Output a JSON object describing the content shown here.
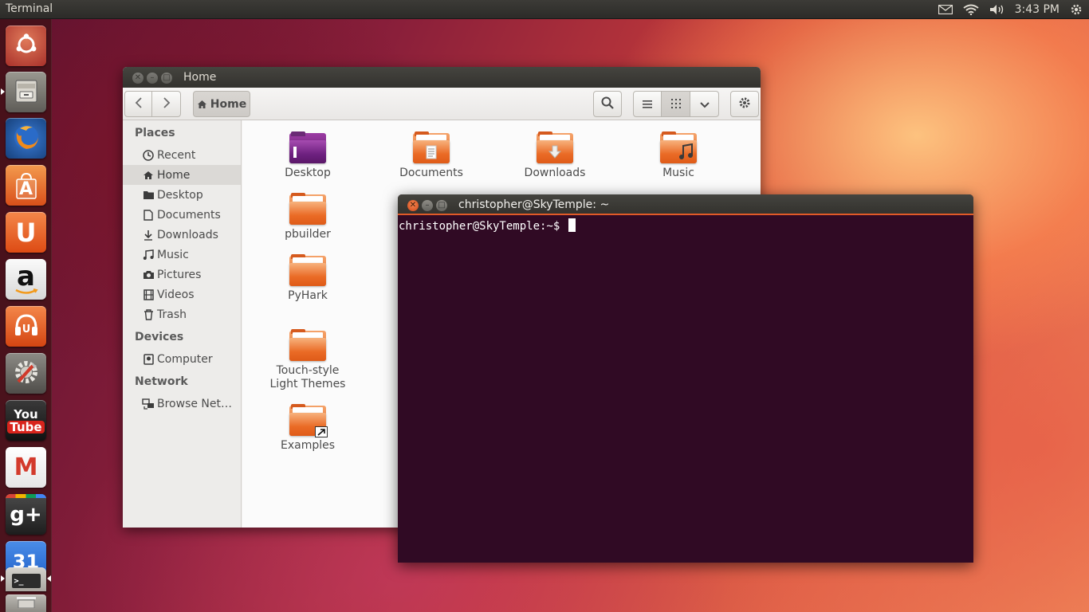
{
  "top_panel": {
    "app_title": "Terminal",
    "clock": "3:43 PM",
    "indicators": [
      "mail-icon",
      "wifi-icon",
      "volume-icon",
      "gear-icon"
    ]
  },
  "launcher": {
    "items": [
      {
        "name": "dash-home",
        "icon": "ubuntu-logo-icon"
      },
      {
        "name": "files",
        "icon": "file-cabinet-icon"
      },
      {
        "name": "firefox",
        "icon": "firefox-icon"
      },
      {
        "name": "software-center",
        "icon": "shopping-bag-icon",
        "glyph": "A"
      },
      {
        "name": "ubuntu-one",
        "icon": "ubuntu-one-icon",
        "glyph": "U"
      },
      {
        "name": "amazon",
        "icon": "amazon-icon",
        "glyph": "a"
      },
      {
        "name": "ubuntu-one-music",
        "icon": "headphones-icon"
      },
      {
        "name": "system-settings",
        "icon": "settings-icon"
      },
      {
        "name": "youtube",
        "icon": "youtube-icon",
        "glyph_top": "You",
        "glyph_bottom": "Tube"
      },
      {
        "name": "gmail",
        "icon": "gmail-icon",
        "glyph": "M"
      },
      {
        "name": "google-plus",
        "icon": "google-plus-icon",
        "glyph": "g+"
      },
      {
        "name": "calendar",
        "icon": "calendar-icon",
        "glyph": "31"
      },
      {
        "name": "terminal",
        "icon": "terminal-icon",
        "glyph": ">_"
      },
      {
        "name": "trash",
        "icon": "trash-icon"
      }
    ]
  },
  "files_window": {
    "title": "Home",
    "toolbar": {
      "back_icon": "chevron-left-icon",
      "forward_icon": "chevron-right-icon",
      "location": "Home",
      "search_icon": "search-icon",
      "list_view_icon": "list-view-icon",
      "grid_view_icon": "grid-view-icon",
      "view_options_icon": "chevron-down-icon",
      "settings_icon": "gear-icon"
    },
    "sidebar": {
      "places_heading": "Places",
      "places": [
        {
          "label": "Recent",
          "icon": "clock-icon"
        },
        {
          "label": "Home",
          "icon": "home-icon",
          "selected": true
        },
        {
          "label": "Desktop",
          "icon": "desktop-folder-icon"
        },
        {
          "label": "Documents",
          "icon": "document-icon"
        },
        {
          "label": "Downloads",
          "icon": "download-icon"
        },
        {
          "label": "Music",
          "icon": "music-icon"
        },
        {
          "label": "Pictures",
          "icon": "camera-icon"
        },
        {
          "label": "Videos",
          "icon": "film-icon"
        },
        {
          "label": "Trash",
          "icon": "trash-icon"
        }
      ],
      "devices_heading": "Devices",
      "devices": [
        {
          "label": "Computer",
          "icon": "drive-icon"
        }
      ],
      "network_heading": "Network",
      "network": [
        {
          "label": "Browse Net…",
          "icon": "network-icon"
        }
      ]
    },
    "items": [
      {
        "label": "Desktop",
        "icon": "desktop-folder-icon"
      },
      {
        "label": "Documents",
        "icon": "documents-folder-icon"
      },
      {
        "label": "Downloads",
        "icon": "downloads-folder-icon"
      },
      {
        "label": "Music",
        "icon": "music-folder-icon"
      },
      {
        "label": "pbuilder",
        "icon": "folder-icon"
      },
      {
        "label": "PyHark",
        "icon": "folder-icon"
      },
      {
        "label": "Touch-style Light Themes",
        "icon": "folder-icon"
      },
      {
        "label": "Examples",
        "icon": "link-folder-icon"
      }
    ]
  },
  "terminal_window": {
    "title": "christopher@SkyTemple: ~",
    "prompt": "christopher@SkyTemple:~$ "
  },
  "colors": {
    "accent": "#e05a28",
    "terminal_bg": "#300a24",
    "panel_bg": "#3c3b37"
  }
}
